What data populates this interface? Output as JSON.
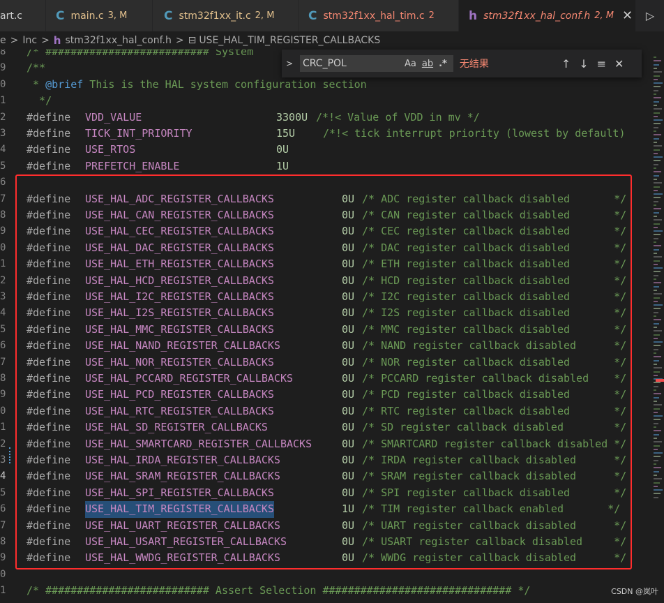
{
  "tabs": [
    {
      "label": "art.c",
      "status": ""
    },
    {
      "icon": "C",
      "label": "main.c",
      "status": "3, M"
    },
    {
      "icon": "C",
      "label": "stm32f1xx_it.c",
      "status": "2, M"
    },
    {
      "icon": "C",
      "label": "stm32f1xx_hal_tim.c",
      "status": "2"
    },
    {
      "icon": "h",
      "label": "stm32f1xx_hal_conf.h",
      "status": "2, M",
      "close": "✕"
    }
  ],
  "run_icon": "▷",
  "breadcrumb": {
    "parts": [
      "e",
      "Inc",
      "stm32f1xx_hal_conf.h",
      "USE_HAL_TIM_REGISTER_CALLBACKS"
    ],
    "sep": ">",
    "file_icon": "h",
    "symbol_icon": "⊟"
  },
  "find": {
    "toggle": ">",
    "value": "CRC_POL",
    "match_case": "Aa",
    "whole_word": "ab",
    "regex": ".*",
    "status": "无结果",
    "prev": "↑",
    "next": "↓",
    "selection": "≡",
    "close": "✕"
  },
  "code": {
    "line_numbers": [
      "8",
      "9",
      "0",
      "1",
      "2",
      "3",
      "4",
      "5",
      "6",
      "7",
      "8",
      "9",
      "0",
      "1",
      "2",
      "3",
      "4",
      "5",
      "6",
      "7",
      "8",
      "9",
      "0",
      "1",
      "2",
      "3",
      "4",
      "5",
      "6",
      "7",
      "8",
      "9",
      "0",
      "1"
    ],
    "top_partial": "/* ########################## System",
    "doc_open": "/**",
    "brief_star": " * ",
    "brief_tag": "@brief",
    "brief_text": " This is the HAL system configuration section",
    "doc_close": "  */",
    "defines_top": [
      {
        "name": "VDD_VALUE",
        "value": "3300U",
        "comment": "/*!< Value of VDD in mv */"
      },
      {
        "name": "TICK_INT_PRIORITY",
        "value": "15U",
        "comment": "/*!< tick interrupt priority (lowest by default)"
      },
      {
        "name": "USE_RTOS",
        "value": "0U",
        "comment": ""
      },
      {
        "name": "PREFETCH_ENABLE",
        "value": "1U",
        "comment": ""
      }
    ],
    "define_kw": "#define",
    "callbacks": [
      {
        "name": "USE_HAL_ADC_REGISTER_CALLBACKS",
        "value": "0U",
        "comment": "/* ADC register callback disabled       */"
      },
      {
        "name": "USE_HAL_CAN_REGISTER_CALLBACKS",
        "value": "0U",
        "comment": "/* CAN register callback disabled       */"
      },
      {
        "name": "USE_HAL_CEC_REGISTER_CALLBACKS",
        "value": "0U",
        "comment": "/* CEC register callback disabled       */"
      },
      {
        "name": "USE_HAL_DAC_REGISTER_CALLBACKS",
        "value": "0U",
        "comment": "/* DAC register callback disabled       */"
      },
      {
        "name": "USE_HAL_ETH_REGISTER_CALLBACKS",
        "value": "0U",
        "comment": "/* ETH register callback disabled       */"
      },
      {
        "name": "USE_HAL_HCD_REGISTER_CALLBACKS",
        "value": "0U",
        "comment": "/* HCD register callback disabled       */"
      },
      {
        "name": "USE_HAL_I2C_REGISTER_CALLBACKS",
        "value": "0U",
        "comment": "/* I2C register callback disabled       */"
      },
      {
        "name": "USE_HAL_I2S_REGISTER_CALLBACKS",
        "value": "0U",
        "comment": "/* I2S register callback disabled       */"
      },
      {
        "name": "USE_HAL_MMC_REGISTER_CALLBACKS",
        "value": "0U",
        "comment": "/* MMC register callback disabled       */"
      },
      {
        "name": "USE_HAL_NAND_REGISTER_CALLBACKS",
        "value": "0U",
        "comment": "/* NAND register callback disabled      */"
      },
      {
        "name": "USE_HAL_NOR_REGISTER_CALLBACKS",
        "value": "0U",
        "comment": "/* NOR register callback disabled       */"
      },
      {
        "name": "USE_HAL_PCCARD_REGISTER_CALLBACKS",
        "value": "0U",
        "comment": "/* PCCARD register callback disabled    */"
      },
      {
        "name": "USE_HAL_PCD_REGISTER_CALLBACKS",
        "value": "0U",
        "comment": "/* PCD register callback disabled       */"
      },
      {
        "name": "USE_HAL_RTC_REGISTER_CALLBACKS",
        "value": "0U",
        "comment": "/* RTC register callback disabled       */"
      },
      {
        "name": "USE_HAL_SD_REGISTER_CALLBACKS",
        "value": "0U",
        "comment": "/* SD register callback disabled        */"
      },
      {
        "name": "USE_HAL_SMARTCARD_REGISTER_CALLBACKS",
        "value": "0U",
        "comment": "/* SMARTCARD register callback disabled */"
      },
      {
        "name": "USE_HAL_IRDA_REGISTER_CALLBACKS",
        "value": "0U",
        "comment": "/* IRDA register callback disabled      */"
      },
      {
        "name": "USE_HAL_SRAM_REGISTER_CALLBACKS",
        "value": "0U",
        "comment": "/* SRAM register callback disabled      */"
      },
      {
        "name": "USE_HAL_SPI_REGISTER_CALLBACKS",
        "value": "0U",
        "comment": "/* SPI register callback disabled       */"
      },
      {
        "name": "USE_HAL_TIM_REGISTER_CALLBACKS",
        "value": "1U",
        "comment": "/* TIM register callback enabled       */",
        "selected": true
      },
      {
        "name": "USE_HAL_UART_REGISTER_CALLBACKS",
        "value": "0U",
        "comment": "/* UART register callback disabled      */"
      },
      {
        "name": "USE_HAL_USART_REGISTER_CALLBACKS",
        "value": "0U",
        "comment": "/* USART register callback disabled     */"
      },
      {
        "name": "USE_HAL_WWDG_REGISTER_CALLBACKS",
        "value": "0U",
        "comment": "/* WWDG register callback disabled      */"
      }
    ],
    "assert_line": "/* ########################## Assert Selection ############################## */",
    "last_line": "/**"
  },
  "watermark": "CSDN @岚叶",
  "colors": {
    "accent_red": "#ff2d2d",
    "selection": "#264f78",
    "comment": "#6a9955",
    "macro": "#c586c0",
    "number": "#b5cea8"
  }
}
